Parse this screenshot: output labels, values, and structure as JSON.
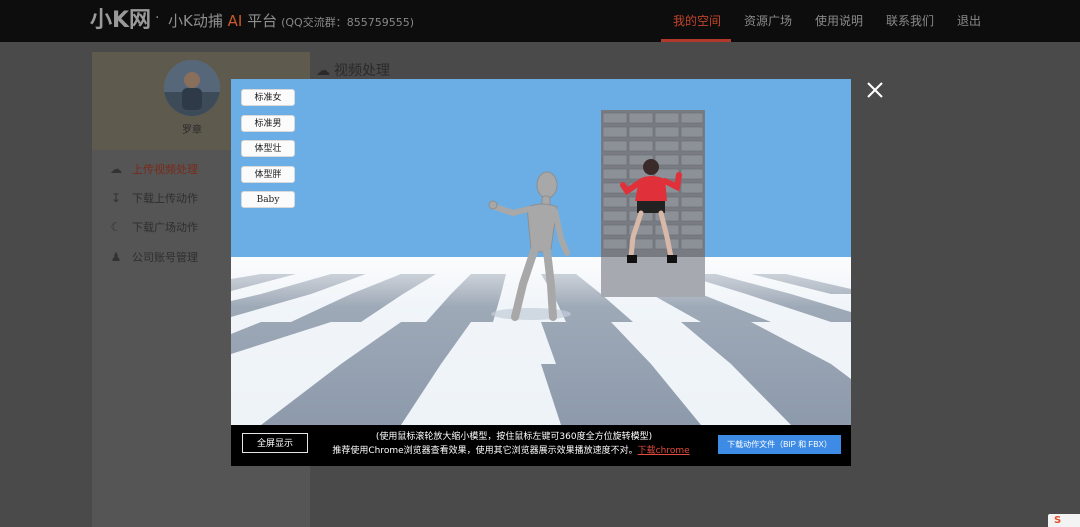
{
  "header": {
    "logo": "小K网",
    "separator": "·",
    "brand_prefix": "小K动捕",
    "brand_ai": "AI",
    "brand_suffix": "平台",
    "qq_group": "(QQ交流群：855759555)",
    "nav": [
      "我的空间",
      "资源广场",
      "使用说明",
      "联系我们",
      "退出"
    ],
    "active_nav": "我的空间"
  },
  "sidebar": {
    "username": "罗章",
    "items": [
      {
        "label": "上传视频处理",
        "icon": "upload-cloud-icon",
        "active": true
      },
      {
        "label": "下载上传动作",
        "icon": "download-icon",
        "active": false
      },
      {
        "label": "下载广场动作",
        "icon": "planet-icon",
        "active": false
      },
      {
        "label": "公司账号管理",
        "icon": "user-lock-icon",
        "active": false
      }
    ]
  },
  "content": {
    "title": "视频处理",
    "title_icon": "upload-cloud-icon"
  },
  "modal": {
    "model_buttons": [
      "标准女",
      "标准男",
      "体型壮",
      "体型胖",
      "Baby"
    ],
    "fullscreen_label": "全屏显示",
    "hint_line1": "(使用鼠标滚轮放大缩小模型，按住鼠标左键可360度全方位旋转模型)",
    "hint_line2": "推荐使用Chrome浏览器查看效果，使用其它浏览器展示效果播放速度不对。",
    "chrome_link": "下载chrome",
    "download_label": "下载动作文件（BIP 和 FBX）",
    "close_icon": "close-icon"
  },
  "colors": {
    "sky": "#6aaee5",
    "accent_red": "#b2392a",
    "download_blue": "#3e8be6"
  }
}
